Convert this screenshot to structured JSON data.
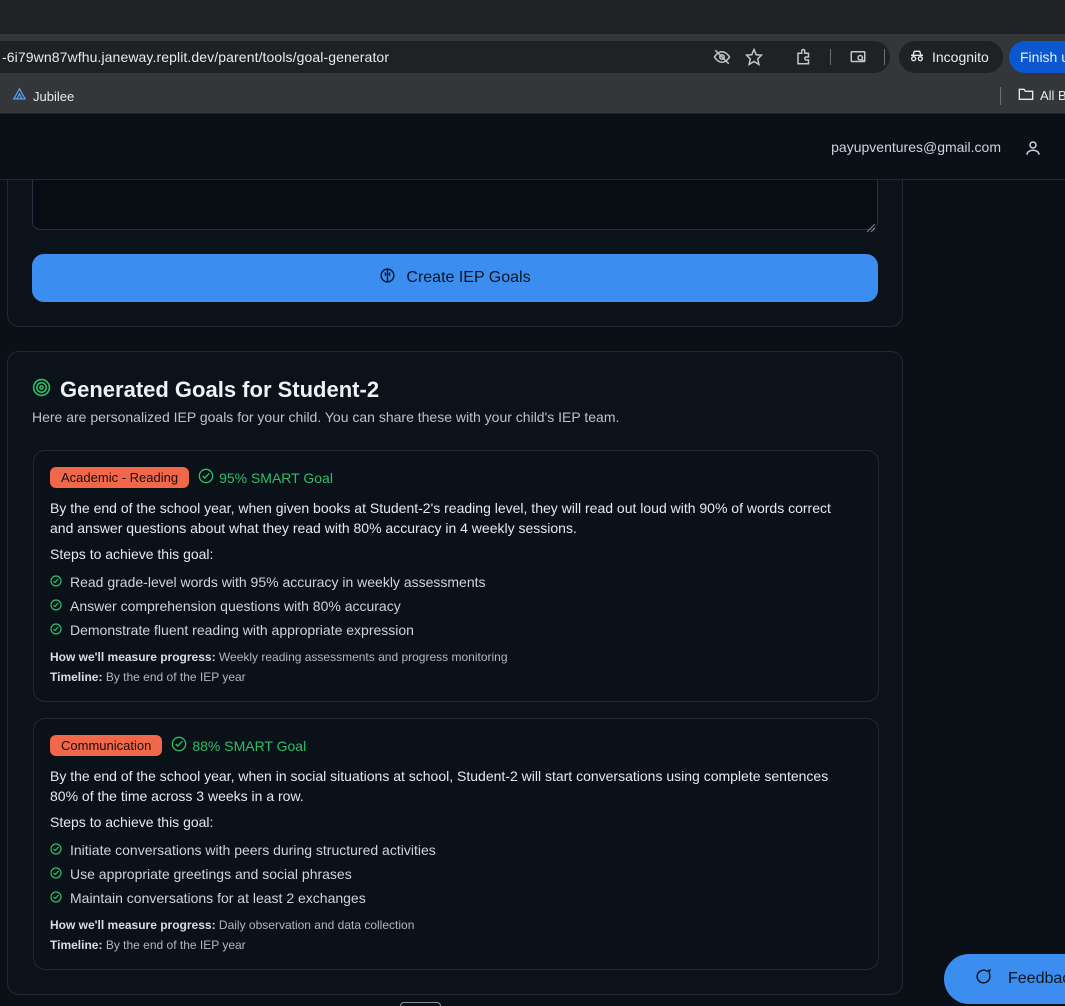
{
  "browser": {
    "url": "-6i79wn87wfhu.janeway.replit.dev/parent/tools/goal-generator",
    "incognito_label": "Incognito",
    "finish_label": "Finish u",
    "bookmarks": {
      "jubilee": "Jubilee",
      "all": "All B"
    }
  },
  "header": {
    "email": "payupventures@gmail.com"
  },
  "form": {
    "create_label": "Create IEP Goals"
  },
  "goals_section": {
    "title": "Generated Goals for Student-2",
    "subtitle": "Here are personalized IEP goals for your child. You can share these with your child's IEP team.",
    "goals": [
      {
        "category": "Academic - Reading",
        "smart": "95% SMART Goal",
        "text": "By the end of the school year, when given books at Student-2's reading level, they will read out loud with 90% of words correct and answer questions about what they read with 80% accuracy in 4 weekly sessions.",
        "steps_label": "Steps to achieve this goal:",
        "steps": [
          "Read grade-level words with 95% accuracy in weekly assessments",
          "Answer comprehension questions with 80% accuracy",
          "Demonstrate fluent reading with appropriate expression"
        ],
        "measure_label": "How we'll measure progress:",
        "measure": "Weekly reading assessments and progress monitoring",
        "timeline_label": "Timeline:",
        "timeline": "By the end of the IEP year"
      },
      {
        "category": "Communication",
        "smart": "88% SMART Goal",
        "text": "By the end of the school year, when in social situations at school, Student-2 will start conversations using complete sentences 80% of the time across 3 weeks in a row.",
        "steps_label": "Steps to achieve this goal:",
        "steps": [
          "Initiate conversations with peers during structured activities",
          "Use appropriate greetings and social phrases",
          "Maintain conversations for at least 2 exchanges"
        ],
        "measure_label": "How we'll measure progress:",
        "measure": "Daily observation and data collection",
        "timeline_label": "Timeline:",
        "timeline": "By the end of the IEP year"
      }
    ]
  },
  "feedback": {
    "label": "Feedback"
  },
  "colors": {
    "accent": "#3b8ef0",
    "badge": "#f0674a",
    "smart": "#2fbf6a"
  }
}
